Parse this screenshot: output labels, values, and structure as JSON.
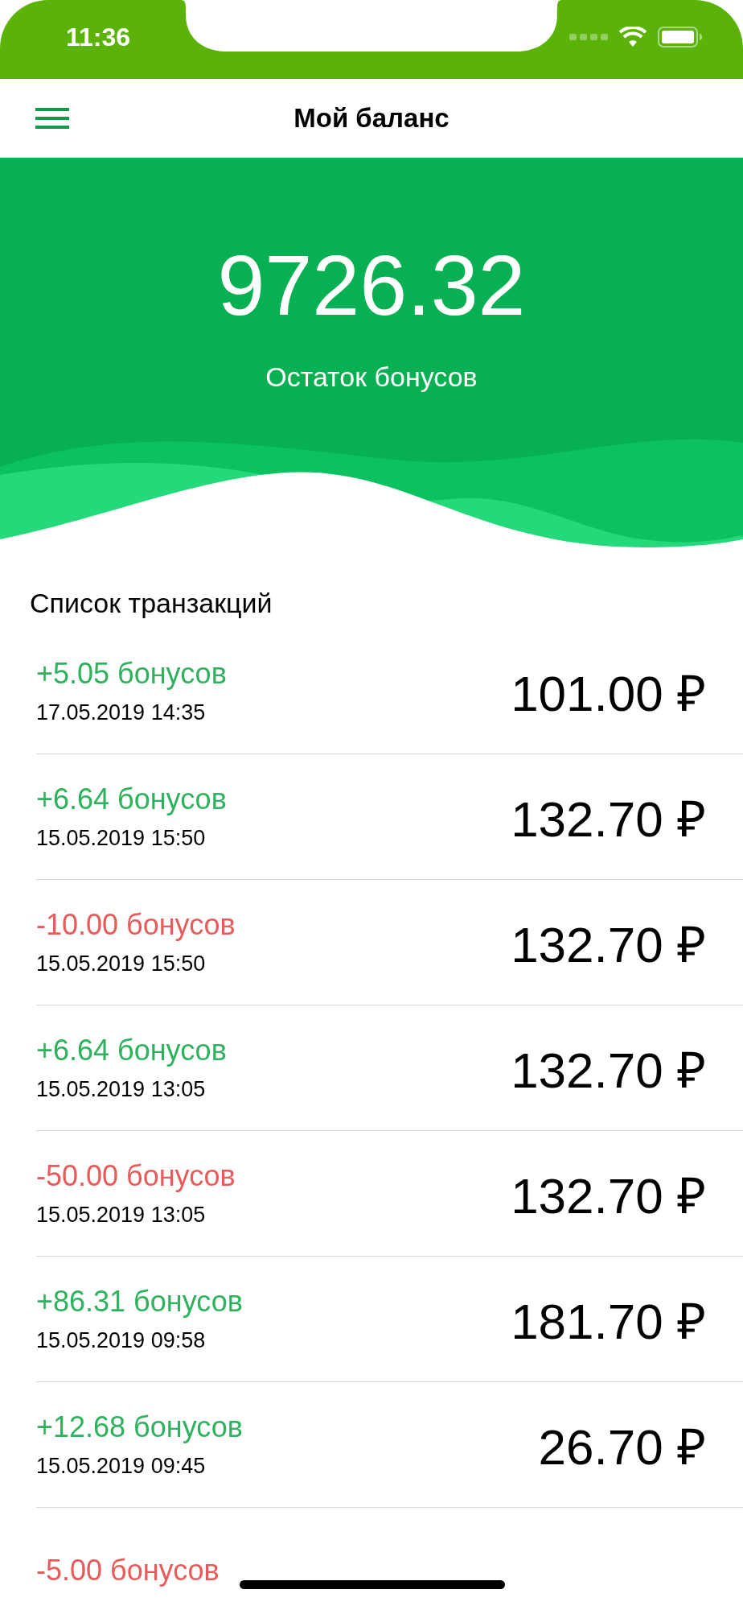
{
  "status_bar": {
    "time": "11:36"
  },
  "nav": {
    "title": "Мой баланс"
  },
  "balance": {
    "amount": "9726.32",
    "caption": "Остаток бонусов"
  },
  "transactions": {
    "title": "Список транзакций",
    "rows": [
      {
        "bonus": "+5.05 бонусов",
        "kind": "credit",
        "date": "17.05.2019 14:35",
        "amount": "101.00 ₽"
      },
      {
        "bonus": "+6.64 бонусов",
        "kind": "credit",
        "date": "15.05.2019 15:50",
        "amount": "132.70 ₽"
      },
      {
        "bonus": "-10.00 бонусов",
        "kind": "debit",
        "date": "15.05.2019 15:50",
        "amount": "132.70 ₽"
      },
      {
        "bonus": "+6.64 бонусов",
        "kind": "credit",
        "date": "15.05.2019 13:05",
        "amount": "132.70 ₽"
      },
      {
        "bonus": "-50.00 бонусов",
        "kind": "debit",
        "date": "15.05.2019 13:05",
        "amount": "132.70 ₽"
      },
      {
        "bonus": "+86.31 бонусов",
        "kind": "credit",
        "date": "15.05.2019 09:58",
        "amount": "181.70 ₽"
      },
      {
        "bonus": "+12.68 бонусов",
        "kind": "credit",
        "date": "15.05.2019 09:45",
        "amount": "26.70 ₽"
      },
      {
        "bonus": "-5.00 бонусов",
        "kind": "debit"
      }
    ]
  }
}
